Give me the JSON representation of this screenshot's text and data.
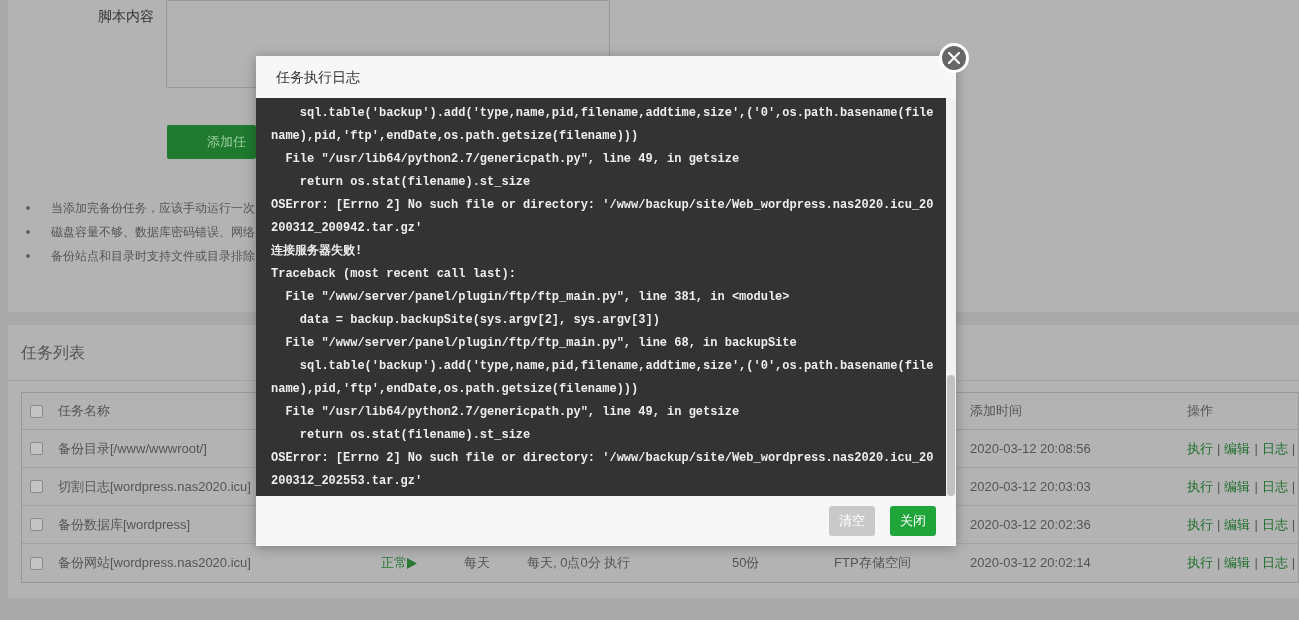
{
  "form": {
    "script_label": "脚本内容",
    "add_button": "添加任"
  },
  "notes": [
    "当添加完备份任务，应该手动运行一次",
    "磁盘容量不够、数据库密码错误、网络",
    "备份站点和目录时支持文件或目录排除"
  ],
  "task_list": {
    "title": "任务列表",
    "select_all_checked": false,
    "header": {
      "name": "任务名称",
      "add_time": "添加时间",
      "actions": "操作"
    },
    "separator": "|",
    "rows": [
      {
        "checked": false,
        "name": "备份目录[/www/wwwroot/]",
        "add_time": "2020-03-12 20:08:56",
        "actions": [
          "执行",
          "编辑",
          "日志"
        ]
      },
      {
        "checked": false,
        "name": "切割日志[wordpress.nas2020.icu]",
        "add_time": "2020-03-12 20:03:03",
        "actions": [
          "执行",
          "编辑",
          "日志"
        ]
      },
      {
        "checked": false,
        "name": "备份数据库[wordpress]",
        "add_time": "2020-03-12 20:02:36",
        "actions": [
          "执行",
          "编辑",
          "日志"
        ]
      },
      {
        "checked": false,
        "name": "备份网站[wordpress.nas2020.icu]",
        "status": "正常",
        "period": "每天",
        "exec_time": "每天, 0点0分 执行",
        "keep": "50份",
        "storage": "FTP存储空间",
        "add_time": "2020-03-12 20:02:14",
        "actions": [
          "执行",
          "编辑",
          "日志"
        ]
      }
    ]
  },
  "dialog": {
    "title": "任务执行日志",
    "log_lines": [
      "    sql.table('backup').add('type,name,pid,filename,addtime,size',('0',os.path.basename(file",
      "name),pid,'ftp',endDate,os.path.getsize(filename)))",
      "  File \"/usr/lib64/python2.7/genericpath.py\", line 49, in getsize",
      "    return os.stat(filename).st_size",
      "OSError: [Errno 2] No such file or directory: '/www/backup/site/Web_wordpress.nas2020.icu_20",
      "200312_200942.tar.gz'",
      "连接服务器失败!",
      "Traceback (most recent call last):",
      "  File \"/www/server/panel/plugin/ftp/ftp_main.py\", line 381, in <module>",
      "    data = backup.backupSite(sys.argv[2], sys.argv[3])",
      "  File \"/www/server/panel/plugin/ftp/ftp_main.py\", line 68, in backupSite",
      "    sql.table('backup').add('type,name,pid,filename,addtime,size',('0',os.path.basename(file",
      "name),pid,'ftp',endDate,os.path.getsize(filename)))",
      "  File \"/usr/lib64/python2.7/genericpath.py\", line 49, in getsize",
      "    return os.stat(filename).st_size",
      "OSError: [Errno 2] No such file or directory: '/www/backup/site/Web_wordpress.nas2020.icu_20",
      "200312_202553.tar.gz'"
    ],
    "buttons": [
      {
        "label": "清空",
        "disabled": true
      },
      {
        "label": "关闭",
        "disabled": false
      }
    ]
  }
}
